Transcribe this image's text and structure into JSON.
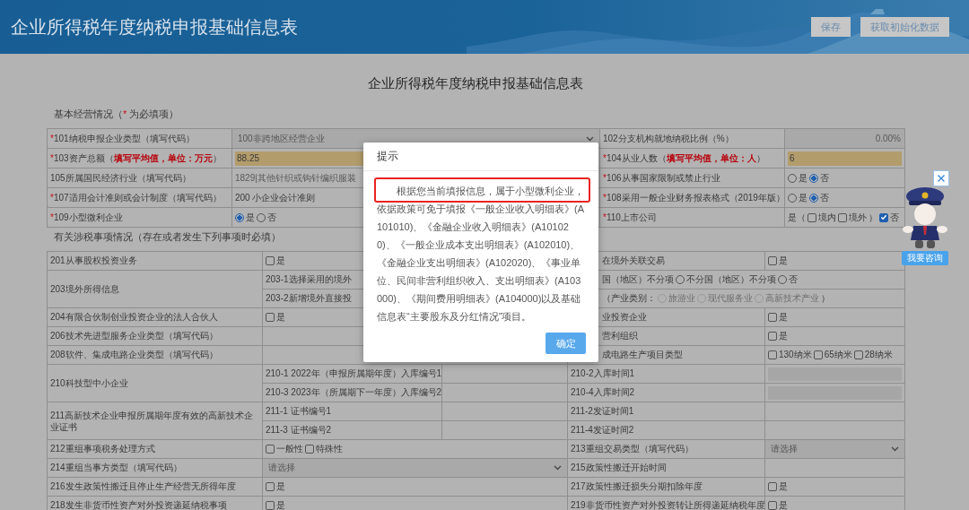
{
  "header": {
    "title": "企业所得税年度纳税申报基础信息表",
    "buttons": [
      "保存",
      "获取初始化数据"
    ]
  },
  "form_title": "企业所得税年度纳税申报基础信息表",
  "basic_section": {
    "heading": {
      "before": "基本经营情况（",
      "mark": "*",
      "after": " 为必填项）"
    },
    "rows": [
      {
        "left": {
          "mark": "*",
          "label": "101纳税申报企业类型（填写代码）",
          "value": {
            "kind": "select",
            "text": "100非跨地区经营企业"
          }
        },
        "right": {
          "label": "102分支机构就地纳税比例（%）",
          "value": {
            "kind": "number",
            "text": "0.00%"
          }
        }
      },
      {
        "left": {
          "mark": "*",
          "label": "103资产总额（**填写平均值，单位：万元**）",
          "value": {
            "kind": "input",
            "text": "88.25"
          }
        },
        "right": {
          "mark": "*",
          "label": "104从业人数（**填写平均值，单位：人**）",
          "value": {
            "kind": "input",
            "text": "6"
          }
        }
      },
      {
        "left": {
          "label": "105所属国民经济行业（填写代码）",
          "value": {
            "kind": "readonly",
            "text": "1829|其他针织或钩针编织服装"
          }
        },
        "right": {
          "mark": "*",
          "label": "106从事国家限制或禁止行业",
          "value": {
            "kind": "controls",
            "items": [
              {
                "kind": "radio",
                "label": "是",
                "selected": false,
                "disabled": false
              },
              {
                "kind": "radio",
                "label": "否",
                "selected": true,
                "disabled": false
              }
            ]
          }
        }
      },
      {
        "left": {
          "mark": "*",
          "label": "107适用会计准则或会计制度（填写代码）",
          "value": {
            "kind": "text",
            "text": "200 小企业会计准则"
          }
        },
        "right": {
          "mark": "*",
          "label": "108采用一般企业财务报表格式（2019年版）",
          "value": {
            "kind": "controls",
            "items": [
              {
                "kind": "radio",
                "label": "是",
                "selected": false,
                "disabled": false
              },
              {
                "kind": "radio",
                "label": "否",
                "selected": true,
                "disabled": false
              }
            ]
          }
        }
      },
      {
        "left": {
          "mark": "*",
          "label": "109小型微利企业",
          "value": {
            "kind": "controls",
            "items": [
              {
                "kind": "radio",
                "label": "是",
                "selected": true,
                "disabled": false
              },
              {
                "kind": "radio",
                "label": "否",
                "selected": false,
                "disabled": false
              }
            ]
          }
        },
        "right": {
          "mark": "*",
          "label": "110上市公司",
          "value": {
            "kind": "controls",
            "items": [
              {
                "kind": "text",
                "text": "是（"
              },
              {
                "kind": "checkbox",
                "label": "境内",
                "checked": false
              },
              {
                "kind": "checkbox",
                "label": "境外",
                "checked": false
              },
              {
                "kind": "text",
                "text": "）"
              },
              {
                "kind": "checkbox",
                "label": "否",
                "checked": true
              }
            ]
          }
        }
      }
    ]
  },
  "tax_section": {
    "heading": "有关涉税事项情况（存在或者发生下列事项时必填）",
    "groups": [
      {
        "label": "201从事股权投资业务",
        "rows": [
          {
            "value": {
              "kind": "controls",
              "items": [
                {
                  "kind": "checkbox",
                  "label": "是",
                  "checked": false
                }
              ]
            },
            "right_label": "在境外关联交易",
            "right_value": {
              "kind": "controls",
              "items": [
                {
                  "kind": "checkbox",
                  "label": "是",
                  "checked": false
                }
              ]
            }
          }
        ]
      },
      {
        "label": "203境外所得信息",
        "rows": [
          {
            "sub_label": "203-1选择采用的境外",
            "wide_value": {
              "kind": "controls",
              "items": [
                {
                  "kind": "text",
                  "text": "国（地区）不分项"
                },
                {
                  "kind": "radio",
                  "label": "不分国（地区）不分项",
                  "selected": false,
                  "disabled": false
                },
                {
                  "kind": "radio",
                  "label": "否",
                  "selected": false,
                  "disabled": false
                }
              ]
            }
          },
          {
            "sub_label": "203-2新增境外直接投",
            "wide_value": {
              "kind": "controls",
              "items": [
                {
                  "kind": "text",
                  "text": "（产业类别："
                },
                {
                  "kind": "radio",
                  "label": "旅游业",
                  "selected": false,
                  "disabled": true
                },
                {
                  "kind": "radio",
                  "label": "现代服务业",
                  "selected": false,
                  "disabled": true
                },
                {
                  "kind": "radio",
                  "label": "高新技术产业",
                  "selected": false,
                  "disabled": true
                },
                {
                  "kind": "text",
                  "text": "）"
                }
              ]
            }
          }
        ]
      },
      {
        "label": "204有限合伙制创业投资企业的法人合伙人",
        "rows": [
          {
            "value": {
              "kind": "controls",
              "items": [
                {
                  "kind": "checkbox",
                  "label": "是",
                  "checked": false
                }
              ]
            },
            "right_label": "业投资企业",
            "right_value": {
              "kind": "controls",
              "items": [
                {
                  "kind": "checkbox",
                  "label": "是",
                  "checked": false
                }
              ]
            }
          }
        ]
      },
      {
        "label": "206技术先进型服务企业类型（填写代码）",
        "rows": [
          {
            "right_label": "营利组织",
            "right_value": {
              "kind": "controls",
              "items": [
                {
                  "kind": "checkbox",
                  "label": "是",
                  "checked": false
                }
              ]
            }
          }
        ]
      },
      {
        "label": "208软件、集成电路企业类型（填写代码）",
        "rows": [
          {
            "right_label": "成电路生产项目类型",
            "right_value": {
              "kind": "controls",
              "items": [
                {
                  "kind": "checkbox",
                  "label": "130纳米",
                  "checked": false
                },
                {
                  "kind": "checkbox",
                  "label": "65纳米",
                  "checked": false
                },
                {
                  "kind": "checkbox",
                  "label": "28纳米",
                  "checked": false
                }
              ]
            }
          }
        ]
      },
      {
        "label": "210科技型中小企业",
        "rows": [
          {
            "sub_label": "210-1 2022年（申报所属期年度）入库编号1",
            "right_label": "210-2入库时间1",
            "right_value": {
              "kind": "field"
            }
          },
          {
            "sub_label": "210-3 2023年（所属期下一年度）入库编号2",
            "right_label": "210-4入库时间2",
            "right_value": {
              "kind": "field"
            }
          }
        ]
      },
      {
        "label": "211高新技术企业申报所属期年度有效的高新技术企业证书",
        "rows": [
          {
            "sub_label": "211-1 证书编号1",
            "right_label": "211-2发证时间1"
          },
          {
            "sub_label": "211-3 证书编号2",
            "right_label": "211-4发证时间2"
          }
        ]
      },
      {
        "label": "212重组事项税务处理方式",
        "rows": [
          {
            "value": {
              "kind": "controls",
              "items": [
                {
                  "kind": "checkbox",
                  "label": "一般性",
                  "checked": false
                },
                {
                  "kind": "checkbox",
                  "label": "特殊性",
                  "checked": false
                }
              ]
            },
            "right_label": "213重组交易类型（填写代码）",
            "right_value": {
              "kind": "select",
              "text": "请选择"
            }
          }
        ]
      },
      {
        "label": "214重组当事方类型（填写代码）",
        "rows": [
          {
            "value": {
              "kind": "select",
              "text": "请选择"
            },
            "right_label": "215政策性搬迁开始时间"
          }
        ]
      },
      {
        "label": "216发生政策性搬迁且停止生产经营无所得年度",
        "rows": [
          {
            "value": {
              "kind": "controls",
              "items": [
                {
                  "kind": "checkbox",
                  "label": "是",
                  "checked": false
                }
              ]
            },
            "right_label": "217政策性搬迁损失分期扣除年度",
            "right_value": {
              "kind": "controls",
              "items": [
                {
                  "kind": "checkbox",
                  "label": "是",
                  "checked": false
                }
              ]
            }
          }
        ]
      },
      {
        "label": "218发生非货币性资产对外投资递延纳税事项",
        "rows": [
          {
            "value": {
              "kind": "controls",
              "items": [
                {
                  "kind": "checkbox",
                  "label": "是",
                  "checked": false
                }
              ]
            },
            "right_label": "219非货币性资产对外投资转让所得递延纳税年度",
            "right_value": {
              "kind": "controls",
              "items": [
                {
                  "kind": "checkbox",
                  "label": "是",
                  "checked": false
                }
              ]
            }
          }
        ]
      }
    ]
  },
  "dialog": {
    "title": "提示",
    "message": "根据您当前填报信息，属于小型微利企业，依据政策可免于填报《一般企业收入明细表》(A101010)、《金融企业收入明细表》(A101020)、《一般企业成本支出明细表》(A102010)、《金融企业支出明细表》(A102020)、《事业单位、民间非营利组织收入、支出明细表》(A103000)、《期间费用明细表》(A104000)以及基础信息表“主要股东及分红情况”项目。",
    "first_line_highlighted": true,
    "button": "确定"
  },
  "assistant": {
    "button": "我要咨询"
  }
}
